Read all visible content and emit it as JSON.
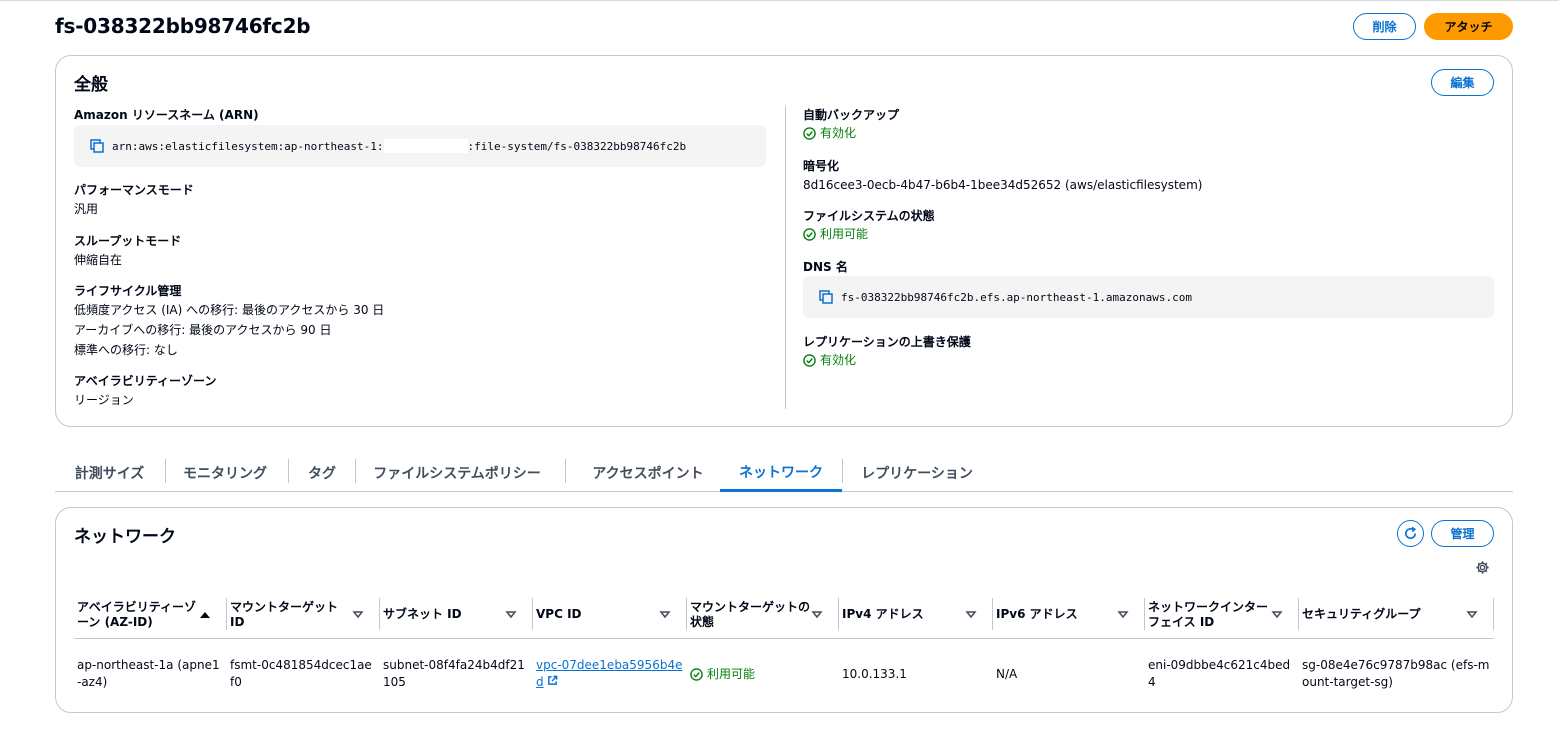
{
  "page": {
    "title": "fs-038322bb98746fc2b",
    "delete_label": "削除",
    "attach_label": "アタッチ"
  },
  "general": {
    "title": "全般",
    "edit_label": "編集",
    "arn_label": "Amazon リソースネーム (ARN)",
    "arn_prefix": "arn:aws:elasticfilesystem:ap-northeast-1:",
    "arn_suffix": ":file-system/fs-038322bb98746fc2b",
    "performance_label": "パフォーマンスモード",
    "performance_value": "汎用",
    "throughput_label": "スループットモード",
    "throughput_value": "伸縮自在",
    "lifecycle_label": "ライフサイクル管理",
    "lifecycle_lines": [
      "低頻度アクセス (IA) への移行: 最後のアクセスから 30 日",
      "アーカイブへの移行: 最後のアクセスから 90 日",
      "標準への移行: なし"
    ],
    "az_label": "アベイラビリティーゾーン",
    "az_value": "リージョン",
    "backup_label": "自動バックアップ",
    "backup_value": "有効化",
    "encryption_label": "暗号化",
    "encryption_value": "8d16cee3-0ecb-4b47-b6b4-1bee34d52652 (aws/elasticfilesystem)",
    "fs_state_label": "ファイルシステムの状態",
    "fs_state_value": "利用可能",
    "dns_label": "DNS 名",
    "dns_value": "fs-038322bb98746fc2b.efs.ap-northeast-1.amazonaws.com",
    "replication_label": "レプリケーションの上書き保護",
    "replication_value": "有効化"
  },
  "tabs": [
    {
      "label": "計測サイズ"
    },
    {
      "label": "モニタリング"
    },
    {
      "label": "タグ"
    },
    {
      "label": "ファイルシステムポリシー"
    },
    {
      "label": "アクセスポイント"
    },
    {
      "label": "ネットワーク",
      "active": true
    },
    {
      "label": "レプリケーション"
    }
  ],
  "network": {
    "title": "ネットワーク",
    "manage_label": "管理",
    "columns": [
      "アベイラビリティーゾーン (AZ-ID)",
      "マウントターゲット ID",
      "サブネット ID",
      "VPC ID",
      "マウントターゲットの状態",
      "IPv4 アドレス",
      "IPv6 アドレス",
      "ネットワークインターフェイス ID",
      "セキュリティグループ"
    ],
    "rows": [
      {
        "az": "ap-northeast-1a (apne1-az4)",
        "mount_target_id": "fsmt-0c481854dcec1aef0",
        "subnet_id": "subnet-08f4fa24b4df21105",
        "vpc_id": "vpc-07dee1eba5956b4ed",
        "state": "利用可能",
        "ipv4": "10.0.133.1",
        "ipv6": "N/A",
        "eni_id": "eni-09dbbe4c621c4bed4",
        "security_group": "sg-08e4e76c9787b98ac (efs-mount-target-sg)"
      }
    ]
  },
  "colors": {
    "accent": "#0972d3",
    "primary": "#ff9900",
    "success": "#037f0c"
  }
}
